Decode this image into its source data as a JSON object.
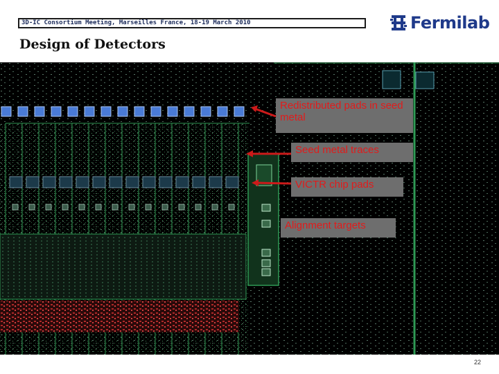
{
  "header": {
    "meeting_text": "3D-IC Consortium Meeting, Marseilles France, 18-19 March 2010",
    "logo_text": "Fermilab"
  },
  "slide": {
    "title": "Design of Detectors",
    "page_number": "22"
  },
  "callouts": [
    {
      "text": "Redistributed pads in seed metal"
    },
    {
      "text": "Seed metal traces"
    },
    {
      "text": "VICTR chip pads"
    },
    {
      "text": "Alignment targets"
    }
  ],
  "colors": {
    "callout_text": "#e11b1b",
    "callout_bg": "#6e6e6e",
    "pad_blue": "#4a7bd6",
    "trace_green": "#2f9a55",
    "title_navy": "#1a2a5a",
    "logo_blue": "#1f3a8a"
  },
  "icons": {
    "logo_mark": "fermilab-logo-icon",
    "arrow": "arrow-left-icon"
  }
}
